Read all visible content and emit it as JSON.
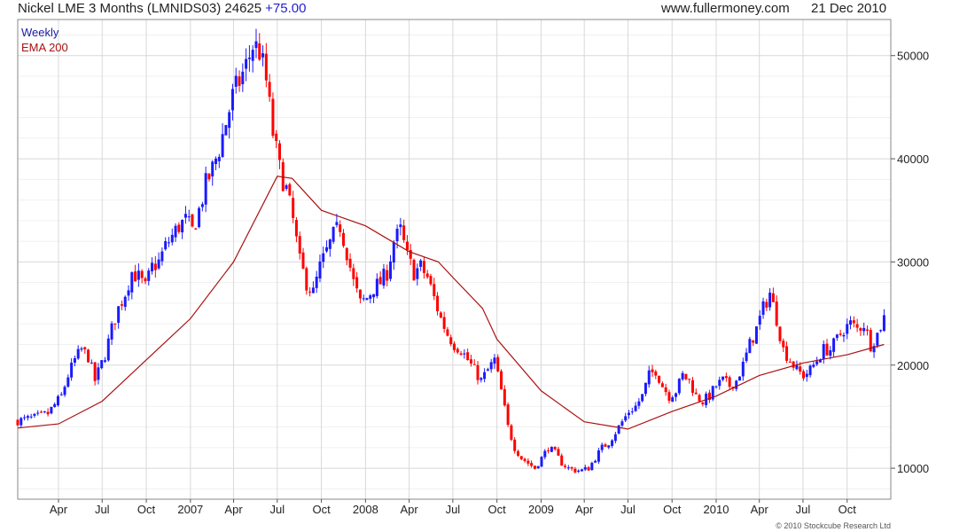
{
  "header": {
    "title": "Nickel LME 3 Months (LMNIDS03) 24625",
    "change": "+75.00",
    "website": "www.fullermoney.com",
    "date": "21 Dec 2010"
  },
  "footer": {
    "copyright": "© 2010 Stockcube Research Ltd"
  },
  "colors": {
    "up": "#1a1aff",
    "down": "#ff0000",
    "ema": "#aa1111",
    "grid": "#d8d8d8",
    "weekly_label": "#1a1aaa",
    "change": "#2222cc"
  },
  "chart_data": {
    "type": "candlestick",
    "x_axis": "time (weekly)",
    "ylim": [
      7000,
      53500
    ],
    "xlim": [
      "2006-01-06",
      "2010-12-31"
    ],
    "y_ticks": [
      10000,
      20000,
      30000,
      40000,
      50000
    ],
    "y_tick_labels": [
      "10000",
      "20000",
      "30000",
      "40000",
      "50000"
    ],
    "x_ticks": [
      {
        "date": "2006-04-01",
        "label": "Apr"
      },
      {
        "date": "2006-07-01",
        "label": "Jul"
      },
      {
        "date": "2006-10-01",
        "label": "Oct"
      },
      {
        "date": "2007-01-01",
        "label": "2007"
      },
      {
        "date": "2007-04-01",
        "label": "Apr"
      },
      {
        "date": "2007-07-01",
        "label": "Jul"
      },
      {
        "date": "2007-10-01",
        "label": "Oct"
      },
      {
        "date": "2008-01-01",
        "label": "2008"
      },
      {
        "date": "2008-04-01",
        "label": "Apr"
      },
      {
        "date": "2008-07-01",
        "label": "Jul"
      },
      {
        "date": "2008-10-01",
        "label": "Oct"
      },
      {
        "date": "2009-01-01",
        "label": "2009"
      },
      {
        "date": "2009-04-01",
        "label": "Apr"
      },
      {
        "date": "2009-07-01",
        "label": "Jul"
      },
      {
        "date": "2009-10-01",
        "label": "Oct"
      },
      {
        "date": "2010-01-01",
        "label": "2010"
      },
      {
        "date": "2010-04-01",
        "label": "Apr"
      },
      {
        "date": "2010-07-01",
        "label": "Jul"
      },
      {
        "date": "2010-10-01",
        "label": "Oct"
      }
    ],
    "legend": [
      "Weekly",
      "EMA 200"
    ],
    "grid": true,
    "legend_position": "top-left",
    "price_series": {
      "name": "Weekly",
      "start_date": "2006-01-06",
      "frequency": "weekly",
      "points": [
        [
          "2006-01-06",
          14600
        ],
        [
          "2006-02-10",
          14900
        ],
        [
          "2006-03-10",
          15300
        ],
        [
          "2006-04-07",
          17000
        ],
        [
          "2006-04-21",
          19000
        ],
        [
          "2006-05-05",
          20500
        ],
        [
          "2006-05-19",
          21500
        ],
        [
          "2006-06-02",
          20800
        ],
        [
          "2006-06-16",
          18500
        ],
        [
          "2006-07-07",
          21000
        ],
        [
          "2006-07-21",
          23500
        ],
        [
          "2006-08-04",
          25500
        ],
        [
          "2006-08-18",
          27000
        ],
        [
          "2006-09-01",
          29000
        ],
        [
          "2006-09-15",
          28500
        ],
        [
          "2006-09-29",
          27500
        ],
        [
          "2006-10-13",
          29500
        ],
        [
          "2006-10-27",
          30000
        ],
        [
          "2006-11-10",
          31500
        ],
        [
          "2006-11-24",
          32500
        ],
        [
          "2006-12-08",
          33500
        ],
        [
          "2006-12-22",
          34000
        ],
        [
          "2007-01-05",
          33000
        ],
        [
          "2007-01-19",
          35000
        ],
        [
          "2007-02-02",
          37500
        ],
        [
          "2007-02-16",
          39000
        ],
        [
          "2007-03-02",
          41000
        ],
        [
          "2007-03-16",
          43500
        ],
        [
          "2007-03-30",
          46000
        ],
        [
          "2007-04-13",
          47500
        ],
        [
          "2007-04-27",
          49000
        ],
        [
          "2007-05-11",
          51000
        ],
        [
          "2007-05-25",
          50500
        ],
        [
          "2007-06-08",
          47500
        ],
        [
          "2007-06-22",
          42500
        ],
        [
          "2007-07-06",
          39000
        ],
        [
          "2007-07-20",
          37000
        ],
        [
          "2007-08-03",
          34000
        ],
        [
          "2007-08-17",
          30000
        ],
        [
          "2007-08-31",
          28000
        ],
        [
          "2007-09-14",
          27000
        ],
        [
          "2007-09-28",
          29500
        ],
        [
          "2007-10-12",
          31000
        ],
        [
          "2007-10-26",
          32500
        ],
        [
          "2007-11-09",
          33500
        ],
        [
          "2007-11-23",
          31000
        ],
        [
          "2007-12-07",
          28000
        ],
        [
          "2007-12-21",
          26000
        ],
        [
          "2008-01-04",
          26500
        ],
        [
          "2008-01-18",
          27500
        ],
        [
          "2008-02-01",
          28000
        ],
        [
          "2008-02-15",
          29000
        ],
        [
          "2008-02-29",
          32000
        ],
        [
          "2008-03-14",
          33000
        ],
        [
          "2008-03-28",
          30500
        ],
        [
          "2008-04-11",
          29000
        ],
        [
          "2008-04-25",
          29500
        ],
        [
          "2008-05-09",
          28500
        ],
        [
          "2008-05-23",
          26500
        ],
        [
          "2008-06-06",
          24500
        ],
        [
          "2008-06-20",
          23000
        ],
        [
          "2008-07-04",
          22000
        ],
        [
          "2008-07-18",
          21500
        ],
        [
          "2008-08-01",
          20500
        ],
        [
          "2008-08-15",
          19500
        ],
        [
          "2008-08-29",
          18500
        ],
        [
          "2008-09-12",
          19500
        ],
        [
          "2008-09-26",
          20500
        ],
        [
          "2008-10-10",
          17500
        ],
        [
          "2008-10-24",
          14000
        ],
        [
          "2008-11-07",
          12000
        ],
        [
          "2008-11-21",
          11000
        ],
        [
          "2008-12-05",
          10500
        ],
        [
          "2008-12-19",
          10000
        ],
        [
          "2009-01-02",
          11000
        ],
        [
          "2009-01-16",
          12000
        ],
        [
          "2009-01-30",
          11500
        ],
        [
          "2009-02-13",
          10500
        ],
        [
          "2009-02-27",
          10000
        ],
        [
          "2009-03-13",
          9800
        ],
        [
          "2009-03-27",
          9800
        ],
        [
          "2009-04-10",
          10000
        ],
        [
          "2009-04-24",
          11000
        ],
        [
          "2009-05-08",
          12000
        ],
        [
          "2009-05-22",
          12500
        ],
        [
          "2009-06-05",
          13500
        ],
        [
          "2009-06-19",
          14500
        ],
        [
          "2009-07-03",
          15500
        ],
        [
          "2009-07-17",
          16000
        ],
        [
          "2009-07-31",
          17000
        ],
        [
          "2009-08-14",
          19000
        ],
        [
          "2009-08-28",
          19500
        ],
        [
          "2009-09-11",
          18000
        ],
        [
          "2009-09-25",
          17000
        ],
        [
          "2009-10-09",
          17500
        ],
        [
          "2009-10-23",
          19000
        ],
        [
          "2009-11-06",
          18500
        ],
        [
          "2009-11-20",
          17000
        ],
        [
          "2009-12-04",
          16500
        ],
        [
          "2009-12-18",
          17000
        ],
        [
          "2010-01-01",
          18000
        ],
        [
          "2010-01-15",
          18500
        ],
        [
          "2010-01-29",
          18000
        ],
        [
          "2010-02-12",
          18500
        ],
        [
          "2010-02-26",
          20000
        ],
        [
          "2010-03-12",
          22000
        ],
        [
          "2010-03-26",
          23500
        ],
        [
          "2010-04-09",
          25500
        ],
        [
          "2010-04-23",
          27000
        ],
        [
          "2010-05-07",
          24500
        ],
        [
          "2010-05-21",
          21500
        ],
        [
          "2010-06-04",
          20500
        ],
        [
          "2010-06-18",
          19500
        ],
        [
          "2010-07-02",
          19000
        ],
        [
          "2010-07-16",
          19500
        ],
        [
          "2010-07-30",
          20500
        ],
        [
          "2010-08-13",
          21500
        ],
        [
          "2010-08-27",
          21500
        ],
        [
          "2010-09-10",
          22500
        ],
        [
          "2010-09-24",
          23500
        ],
        [
          "2010-10-08",
          24000
        ],
        [
          "2010-10-22",
          23500
        ],
        [
          "2010-11-05",
          24000
        ],
        [
          "2010-11-19",
          22000
        ],
        [
          "2010-12-03",
          23000
        ],
        [
          "2010-12-17",
          24625
        ]
      ]
    },
    "ema_series": {
      "name": "EMA 200",
      "points": [
        [
          "2006-01-06",
          13900
        ],
        [
          "2006-04-01",
          14300
        ],
        [
          "2006-07-01",
          16500
        ],
        [
          "2006-10-01",
          20500
        ],
        [
          "2007-01-01",
          24500
        ],
        [
          "2007-04-01",
          30000
        ],
        [
          "2007-07-01",
          38300
        ],
        [
          "2007-08-01",
          38100
        ],
        [
          "2007-10-01",
          35000
        ],
        [
          "2008-01-01",
          33500
        ],
        [
          "2008-04-01",
          31000
        ],
        [
          "2008-06-01",
          30000
        ],
        [
          "2008-07-01",
          28500
        ],
        [
          "2008-09-01",
          25500
        ],
        [
          "2008-10-01",
          22500
        ],
        [
          "2009-01-01",
          17500
        ],
        [
          "2009-04-01",
          14500
        ],
        [
          "2009-07-01",
          13800
        ],
        [
          "2009-10-01",
          15500
        ],
        [
          "2010-01-01",
          17000
        ],
        [
          "2010-04-01",
          19000
        ],
        [
          "2010-07-01",
          20200
        ],
        [
          "2010-10-01",
          21000
        ],
        [
          "2010-12-17",
          22000
        ]
      ]
    }
  }
}
